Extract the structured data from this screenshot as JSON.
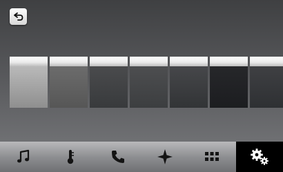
{
  "colors": {
    "icon_dark": "#141414",
    "icon_active": "#ffffff",
    "active_tab_bg": "#000000"
  },
  "back_button": {
    "icon": "back-arrow-icon"
  },
  "swatches": [
    {
      "name": "swatch-1",
      "color_top": "#b9b9b9",
      "color_bottom": "#8f8f8f"
    },
    {
      "name": "swatch-2",
      "color_top": "#6c6c6c",
      "color_bottom": "#565656"
    },
    {
      "name": "swatch-3",
      "color_top": "#4a4b4d",
      "color_bottom": "#383a3c"
    },
    {
      "name": "swatch-4",
      "color_top": "#4d4e50",
      "color_bottom": "#3c3e40"
    },
    {
      "name": "swatch-5",
      "color_top": "#46474a",
      "color_bottom": "#323436"
    },
    {
      "name": "swatch-6",
      "color_top": "#26272a",
      "color_bottom": "#1c1d20"
    },
    {
      "name": "swatch-7",
      "color_top": "#3f4043",
      "color_bottom": "#2e3033"
    }
  ],
  "tabs": [
    {
      "icon": "music-note-icon",
      "active": false
    },
    {
      "icon": "thermometer-icon",
      "active": false
    },
    {
      "icon": "phone-icon",
      "active": false
    },
    {
      "icon": "navigation-star-icon",
      "active": false
    },
    {
      "icon": "apps-grid-icon",
      "active": false
    },
    {
      "icon": "settings-gears-icon",
      "active": true
    }
  ]
}
